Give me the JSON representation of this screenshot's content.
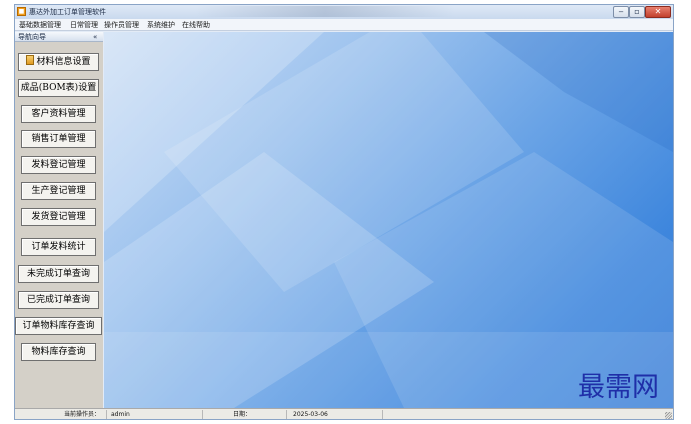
{
  "window": {
    "title": "惠达外加工订单管理软件",
    "icon": "app-icon",
    "controls": {
      "minimize": "‒",
      "maximize": "▫",
      "close": "✕"
    }
  },
  "menu": [
    {
      "label": "基础数据管理"
    },
    {
      "label": "日常管理"
    },
    {
      "label": "操作员管理"
    },
    {
      "label": "系统维护"
    },
    {
      "label": "在线帮助"
    }
  ],
  "nav": {
    "header": "导航向导",
    "collapse": "«",
    "items": [
      {
        "label": "材料信息设置",
        "icon": "document-icon"
      },
      {
        "label": "成品(BOM表)设置"
      },
      {
        "label": "客户资料管理"
      },
      {
        "label": "销售订单管理"
      },
      {
        "label": "发料登记管理"
      },
      {
        "label": "生产登记管理"
      },
      {
        "label": "发货登记管理"
      },
      {
        "label": "订单发料统计"
      },
      {
        "label": "未完成订单查询"
      },
      {
        "label": "已完成订单查询"
      },
      {
        "label": "订单物料库存查询"
      },
      {
        "label": "物料库存查询"
      }
    ]
  },
  "status": {
    "operator_label": "当前操作员：",
    "operator_value": "admin",
    "date_label": "日期：",
    "date_value": "2025-03-06"
  },
  "watermark": "最需网",
  "colors": {
    "accent": "#3f87dd",
    "watermark": "#1f2fa8",
    "nav_background": "#d4d0c8"
  }
}
